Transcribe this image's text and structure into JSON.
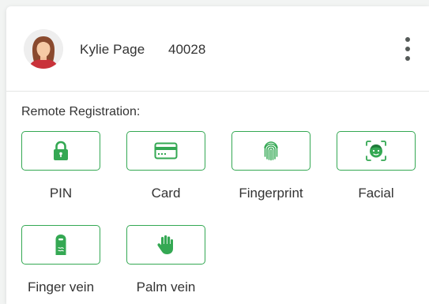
{
  "user": {
    "name": "Kylie Page",
    "id": "40028"
  },
  "header": {
    "more_icon": "more-vertical-icon"
  },
  "registration": {
    "title": "Remote Registration:",
    "accent_color": "#34a853",
    "methods": [
      {
        "label": "PIN",
        "icon": "lock-icon"
      },
      {
        "label": "Card",
        "icon": "card-icon"
      },
      {
        "label": "Fingerprint",
        "icon": "fingerprint-icon"
      },
      {
        "label": "Facial",
        "icon": "face-scan-icon"
      },
      {
        "label": "Finger vein",
        "icon": "finger-vein-icon"
      },
      {
        "label": "Palm vein",
        "icon": "palm-icon"
      }
    ]
  }
}
